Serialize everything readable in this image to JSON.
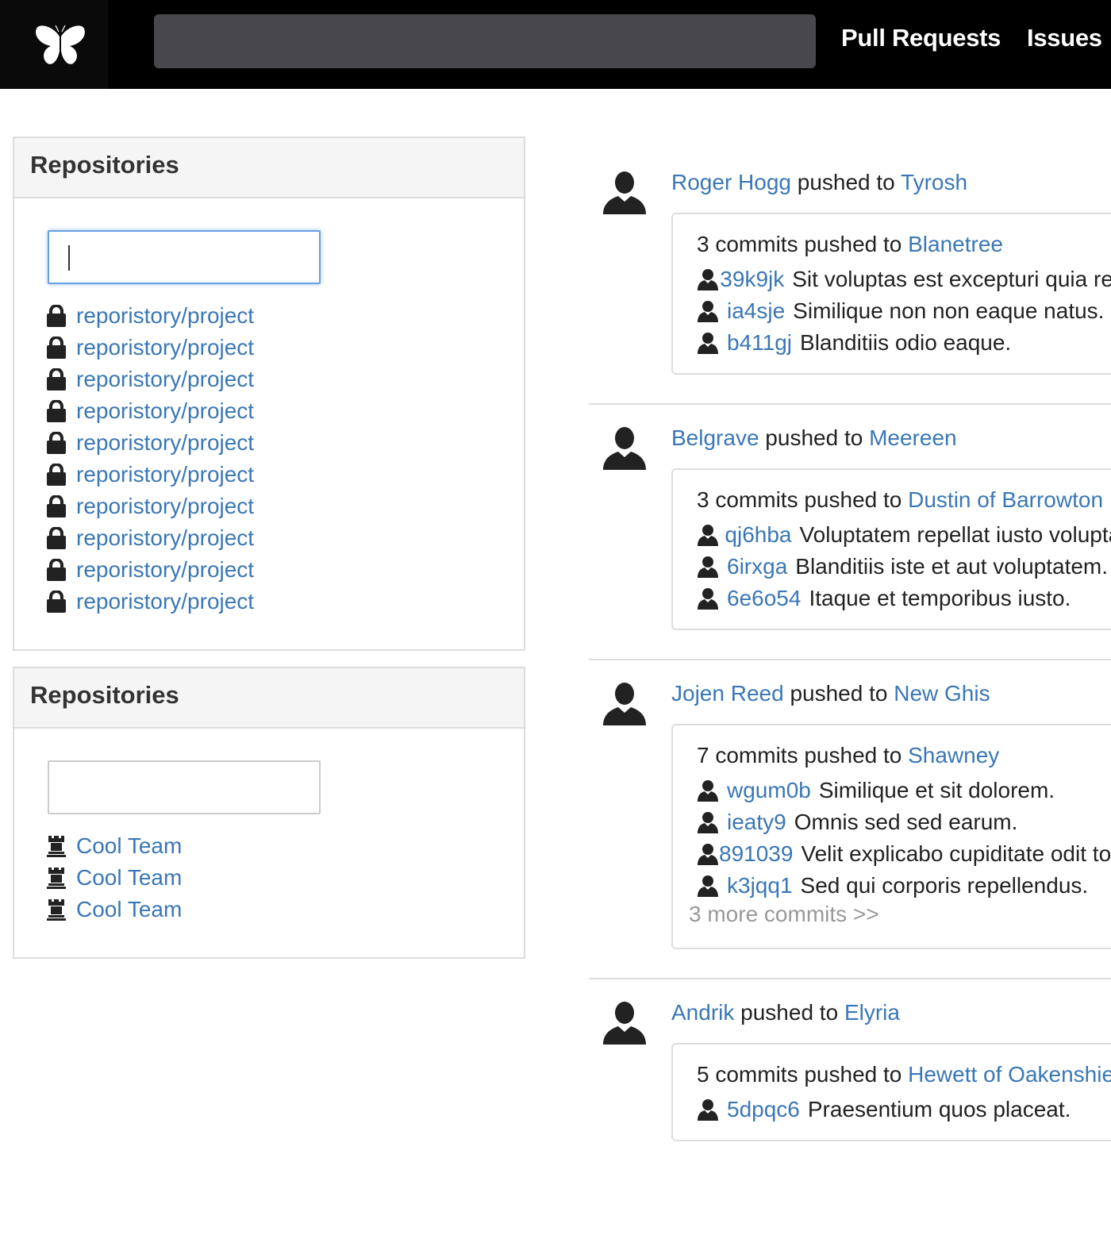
{
  "header": {
    "search_value": "",
    "nav": [
      {
        "label": "Pull Requests"
      },
      {
        "label": "Issues"
      }
    ]
  },
  "repositories_panel": {
    "title": "Repositories",
    "filter_value": "",
    "items": [
      {
        "label": "reporistory/project"
      },
      {
        "label": "reporistory/project"
      },
      {
        "label": "reporistory/project"
      },
      {
        "label": "reporistory/project"
      },
      {
        "label": "reporistory/project"
      },
      {
        "label": "reporistory/project"
      },
      {
        "label": "reporistory/project"
      },
      {
        "label": "reporistory/project"
      },
      {
        "label": "reporistory/project"
      },
      {
        "label": "reporistory/project"
      }
    ]
  },
  "teams_panel": {
    "title": "Repositories",
    "filter_value": "",
    "items": [
      {
        "label": "Cool Team"
      },
      {
        "label": "Cool Team"
      },
      {
        "label": "Cool Team"
      }
    ]
  },
  "feed": [
    {
      "user": "Roger Hogg",
      "action": "pushed to",
      "repo": "Tyrosh",
      "count_text": "3 commits pushed to",
      "branch": "Blanetree",
      "commits": [
        {
          "sha": "39k9jk",
          "message": "Sit voluptas est excepturi quia rem."
        },
        {
          "sha": "ia4sje",
          "message": "Similique non non eaque natus."
        },
        {
          "sha": "b411gj",
          "message": "Blanditiis odio eaque."
        }
      ]
    },
    {
      "user": "Belgrave",
      "action": "pushed to",
      "repo": "Meereen",
      "count_text": "3 commits pushed to",
      "branch": "Dustin of Barrowton",
      "commits": [
        {
          "sha": "qj6hba",
          "message": "Voluptatem repellat iusto voluptas."
        },
        {
          "sha": "6irxga",
          "message": "Blanditiis iste et aut voluptatem."
        },
        {
          "sha": "6e6o54",
          "message": "Itaque et temporibus iusto."
        }
      ]
    },
    {
      "user": "Jojen Reed",
      "action": "pushed to",
      "repo": "New Ghis",
      "count_text": "7 commits pushed to",
      "branch": "Shawney",
      "commits": [
        {
          "sha": "wgum0b",
          "message": "Similique et sit dolorem."
        },
        {
          "sha": "ieaty9",
          "message": "Omnis sed sed earum."
        },
        {
          "sha": "891039",
          "message": "Velit explicabo cupiditate odit totam."
        },
        {
          "sha": "k3jqq1",
          "message": "Sed qui corporis repellendus."
        }
      ],
      "more": "3 more commits >>"
    },
    {
      "user": "Andrik",
      "action": "pushed to",
      "repo": "Elyria",
      "count_text": "5 commits pushed to",
      "branch": "Hewett of Oakenshield",
      "commits": [
        {
          "sha": "5dpqc6",
          "message": "Praesentium quos placeat."
        }
      ]
    }
  ]
}
